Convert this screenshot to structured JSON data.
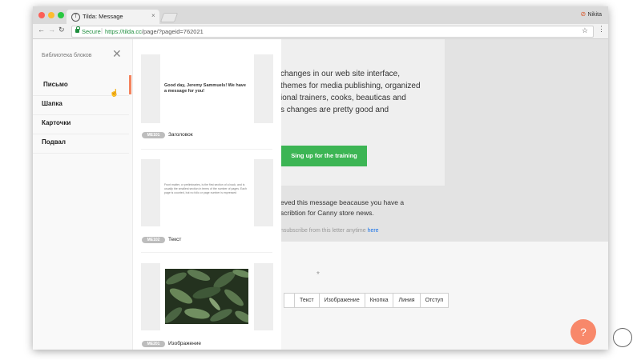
{
  "browser": {
    "tab_title": "Tilda: Message",
    "tab_close": "×",
    "profile_name": "Nikita",
    "secure_label": "Secure",
    "url_host": "https://tilda.cc",
    "url_path": "/page/?pageid=762021"
  },
  "sidebar": {
    "title": "Библиотека блоков",
    "categories": [
      {
        "label": "Письмо",
        "active": true
      },
      {
        "label": "Шапка"
      },
      {
        "label": "Карточки"
      },
      {
        "label": "Подвал"
      }
    ]
  },
  "panel": {
    "cards": [
      {
        "code": "ME101",
        "label": "Заголовок",
        "preview_text": "Good day, Jeremy Sammuels! We have a message for you!"
      },
      {
        "code": "ME102",
        "label": "Текст",
        "preview_text": "Front matter, or preliminaries, is the first section of a book, and is usually the smallest section in terms of the number of pages. Each page is counted, but no folio or page number is expressed"
      },
      {
        "code": "ME201",
        "label": "Изображение"
      }
    ]
  },
  "email": {
    "body_lines": [
      "changes in our web site interface,",
      "themes for media publishing, organized",
      "ional trainers, cooks, beauticas and",
      "s changes are pretty good and"
    ],
    "button_label": "Sing up for the training",
    "notice_lines": [
      "eved this message beacause you have a",
      "scribtion for Canny store news."
    ],
    "unsubscribe_text": "nsubscribe from this letter anytime",
    "unsubscribe_link": "here"
  },
  "editor": {
    "star": "*",
    "block_buttons": [
      "",
      "Текст",
      "Изображение",
      "Кнопка",
      "Линия",
      "Отступ"
    ],
    "help_label": "?"
  },
  "colors": {
    "accent": "#f4845f",
    "button_green": "#3cb554",
    "secure_green": "#1e8e3e"
  }
}
